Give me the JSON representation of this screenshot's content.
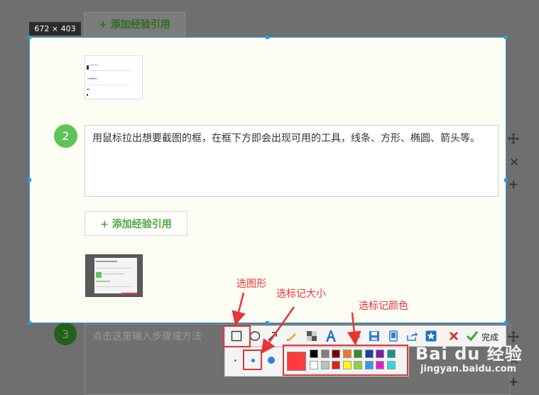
{
  "background": {
    "add_experience_button": "+ 添加经验引用",
    "step3_number": "3",
    "step3_placeholder": "点击这里输入步骤或方法",
    "side_icons": [
      "move-icon",
      "close-icon",
      "plus-icon"
    ]
  },
  "capture": {
    "size_label": "672 × 403",
    "step_number": "2",
    "step_text": "用鼠标拉出想要截图的框，在框下方即会出现可用的工具，线条、方形、椭圆、箭头等。",
    "add_experience_button": "+ 添加经验引用"
  },
  "toolbar": {
    "tools": [
      "rectangle-icon",
      "ellipse-icon",
      "arrow-icon",
      "pen-icon",
      "mosaic-icon",
      "text-icon",
      "undo-icon",
      "save-icon",
      "copy-icon",
      "share-icon",
      "star-icon",
      "cancel-icon",
      "confirm-icon"
    ],
    "done_label": "完成",
    "brush_sizes": [
      "small",
      "medium",
      "large"
    ],
    "selected_brush_size": "medium",
    "selected_color": "#ff3b3b",
    "palette_top": [
      "#000000",
      "#808080",
      "#800000",
      "#e87c22",
      "#2f8f2f",
      "#1c3fa8",
      "#7a1fa2",
      "#1f8c8c"
    ],
    "palette_bottom": [
      "#ffffff",
      "#c0c0c0",
      "#e02020",
      "#ffff00",
      "#8ed13b",
      "#2f9be8",
      "#e21fd8",
      "#2fd8e0"
    ]
  },
  "annotations": {
    "shape_label": "选图形",
    "size_label": "选标记大小",
    "color_label": "选标记颜色"
  },
  "watermark": {
    "brand": "Bai du 经验",
    "url": "jingyan.baidu.com"
  }
}
